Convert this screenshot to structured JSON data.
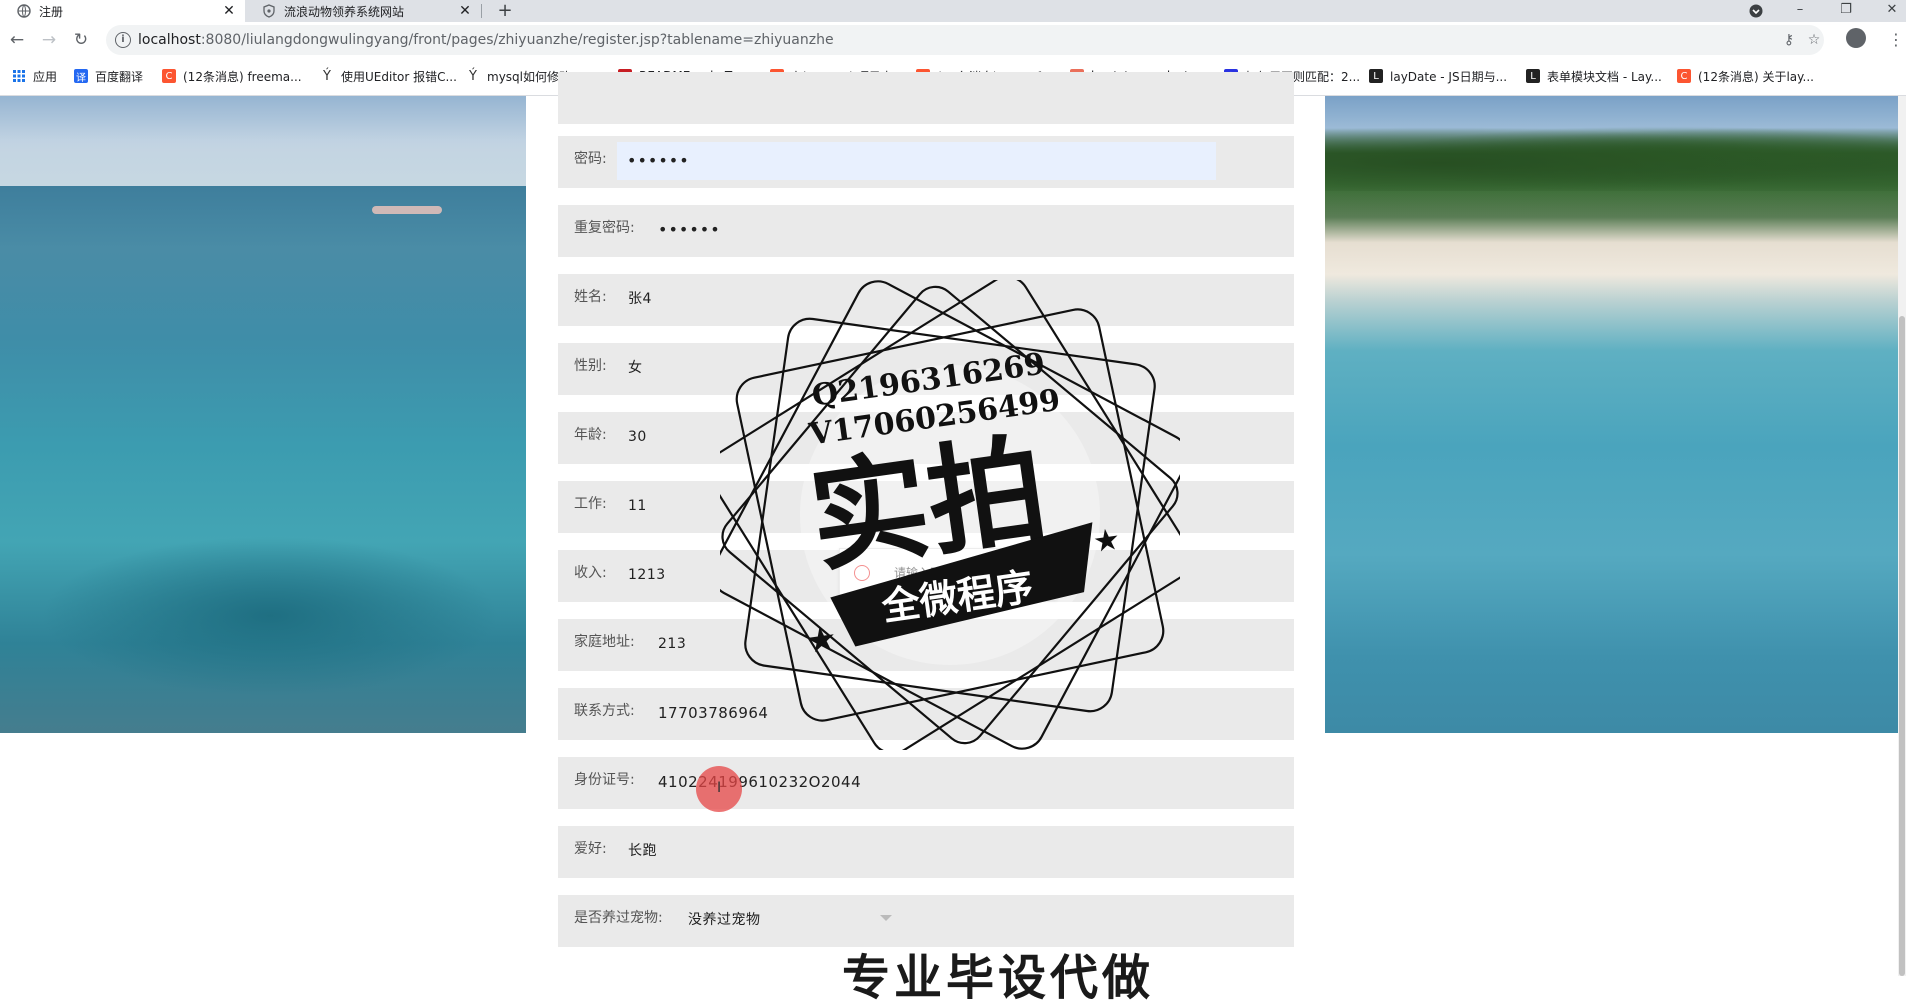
{
  "browser": {
    "tabs": [
      {
        "title": "注册",
        "active": true
      },
      {
        "title": "流浪动物领养系统网站",
        "active": false
      }
    ],
    "url_host": "localhost",
    "url_rest": ":8080/liulangdongwulingyang/front/pages/zhiyuanzhe/register.jsp?tablename=zhiyuanzhe",
    "bookmarks": [
      {
        "label": "应用",
        "icon": "apps-grid-icon"
      },
      {
        "label": "百度翻译",
        "icon": "baidu-translate-icon",
        "color": "#2468f2"
      },
      {
        "label": "(12条消息) freema...",
        "icon": "csdn-icon",
        "color": "#fc5531"
      },
      {
        "label": "使用UEditor 报错C...",
        "icon": "fork-icon"
      },
      {
        "label": "mysql如何修改roo...",
        "icon": "fork-icon"
      },
      {
        "label": "README.md · Ter...",
        "icon": "gitee-icon",
        "color": "#c71d23"
      },
      {
        "label": "在java web项目中...",
        "icon": "csdn-icon",
        "color": "#fc5531"
      },
      {
        "label": "(12条消息) root of...",
        "icon": "csdn-icon",
        "color": "#fc5531"
      },
      {
        "label": "bootstrap-select...",
        "icon": "jianshu-icon",
        "color": "#ea6f5a"
      },
      {
        "label": "如何用正则匹配：2...",
        "icon": "baidu-paw-icon",
        "color": "#2932e1"
      },
      {
        "label": "layDate - JS日期与...",
        "icon": "layui-icon",
        "color": "#222222"
      },
      {
        "label": "表单模块文档 - Lay...",
        "icon": "layui-icon",
        "color": "#222222"
      },
      {
        "label": "(12条消息) 关于lay...",
        "icon": "csdn-icon",
        "color": "#fc5531"
      }
    ]
  },
  "form": {
    "rows": [
      {
        "label": "",
        "value": ""
      },
      {
        "label": "密码:",
        "value": "••••••",
        "type": "password"
      },
      {
        "label": "重复密码:",
        "value": "••••••"
      },
      {
        "label": "姓名:",
        "value": "张4"
      },
      {
        "label": "性别:",
        "value": "女"
      },
      {
        "label": "年龄:",
        "value": "30"
      },
      {
        "label": "工作:",
        "value": "11"
      },
      {
        "label": "收入:",
        "value": "1213"
      },
      {
        "label": "家庭地址:",
        "value": "213"
      },
      {
        "label": "联系方式:",
        "value": "17703786964"
      },
      {
        "label": "身份证号:",
        "value": "410224199610232O2044"
      },
      {
        "label": "爱好:",
        "value": "长跑"
      },
      {
        "label": "是否养过宠物:",
        "value": "没养过宠物",
        "type": "select"
      }
    ],
    "tooltip": "请输入正确的身份证号"
  },
  "watermark": {
    "line1": "Q2196316269",
    "line2": "V17060256499",
    "big": "实拍",
    "banner": "全微程序"
  },
  "bottom_title": "专业毕设代做"
}
